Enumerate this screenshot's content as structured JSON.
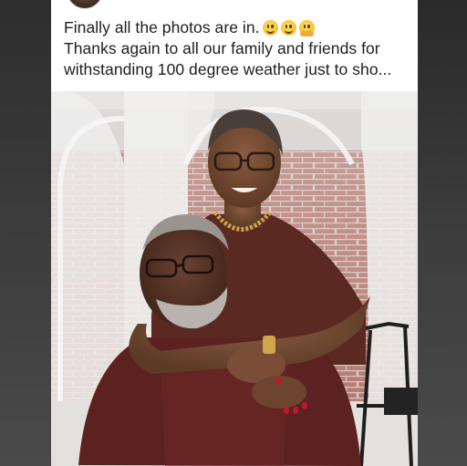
{
  "post": {
    "caption_line_1": "Finally all the photos are in.",
    "caption_line_2": "Thanks again to all our family and friends for",
    "caption_line_3": "withstanding 100 degree weather just to sho...",
    "emojis": [
      "grinning-face",
      "smiling-face",
      "hugging-face"
    ]
  },
  "colors": {
    "text": "#1c1e21",
    "card_background": "#ffffff",
    "page_background": "#3a3a3a"
  }
}
